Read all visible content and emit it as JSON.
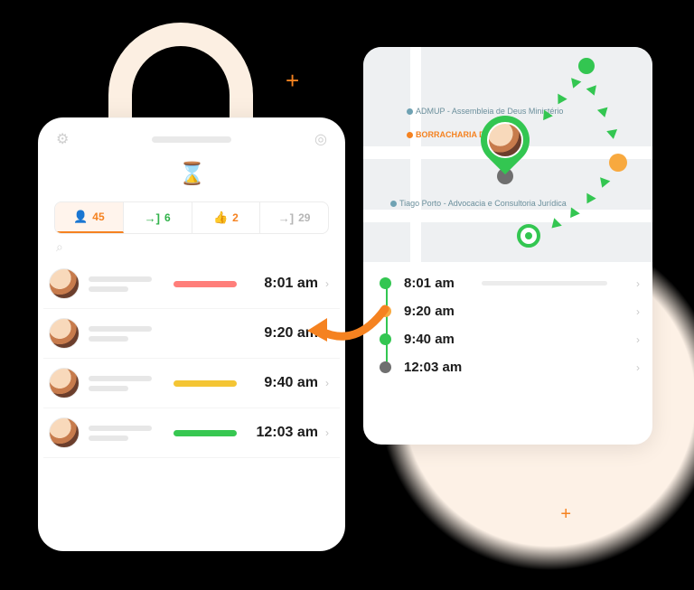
{
  "decor": {
    "plus": "+"
  },
  "colors": {
    "accent_orange": "#f58220",
    "accent_green": "#33c651",
    "accent_yellow": "#f4c534",
    "accent_red": "#ff7e7a",
    "amber": "#f8a93f",
    "grey": "#6f6f6f"
  },
  "phone": {
    "logo": "⌛",
    "icons": {
      "settings": "gear-icon",
      "target": "target-icon",
      "search": "search-icon"
    },
    "tabs": [
      {
        "icon": "👤",
        "count": "45",
        "active": true
      },
      {
        "icon": "→]",
        "count": "6"
      },
      {
        "icon": "👍",
        "count": "2"
      },
      {
        "icon": "→]",
        "count": "29"
      }
    ],
    "rows": [
      {
        "status": "red",
        "time": "8:01 am"
      },
      {
        "status": "none",
        "time": "9:20 am"
      },
      {
        "status": "yellow",
        "time": "9:40 am"
      },
      {
        "status": "green",
        "time": "12:03 am"
      }
    ]
  },
  "mapcard": {
    "labels": {
      "poi1": "ADMUP - Assembleia de Deus Ministério",
      "poi2": "BORRACHARIA DO SIDINHO",
      "poi3": "Tiago Porto - Advocacia e Consultoria Jurídica"
    },
    "timeline": [
      {
        "dot": "g",
        "time": "8:01 am"
      },
      {
        "dot": "o",
        "time": "9:20 am"
      },
      {
        "dot": "g",
        "time": "9:40 am"
      },
      {
        "dot": "gr",
        "time": "12:03 am"
      }
    ]
  }
}
